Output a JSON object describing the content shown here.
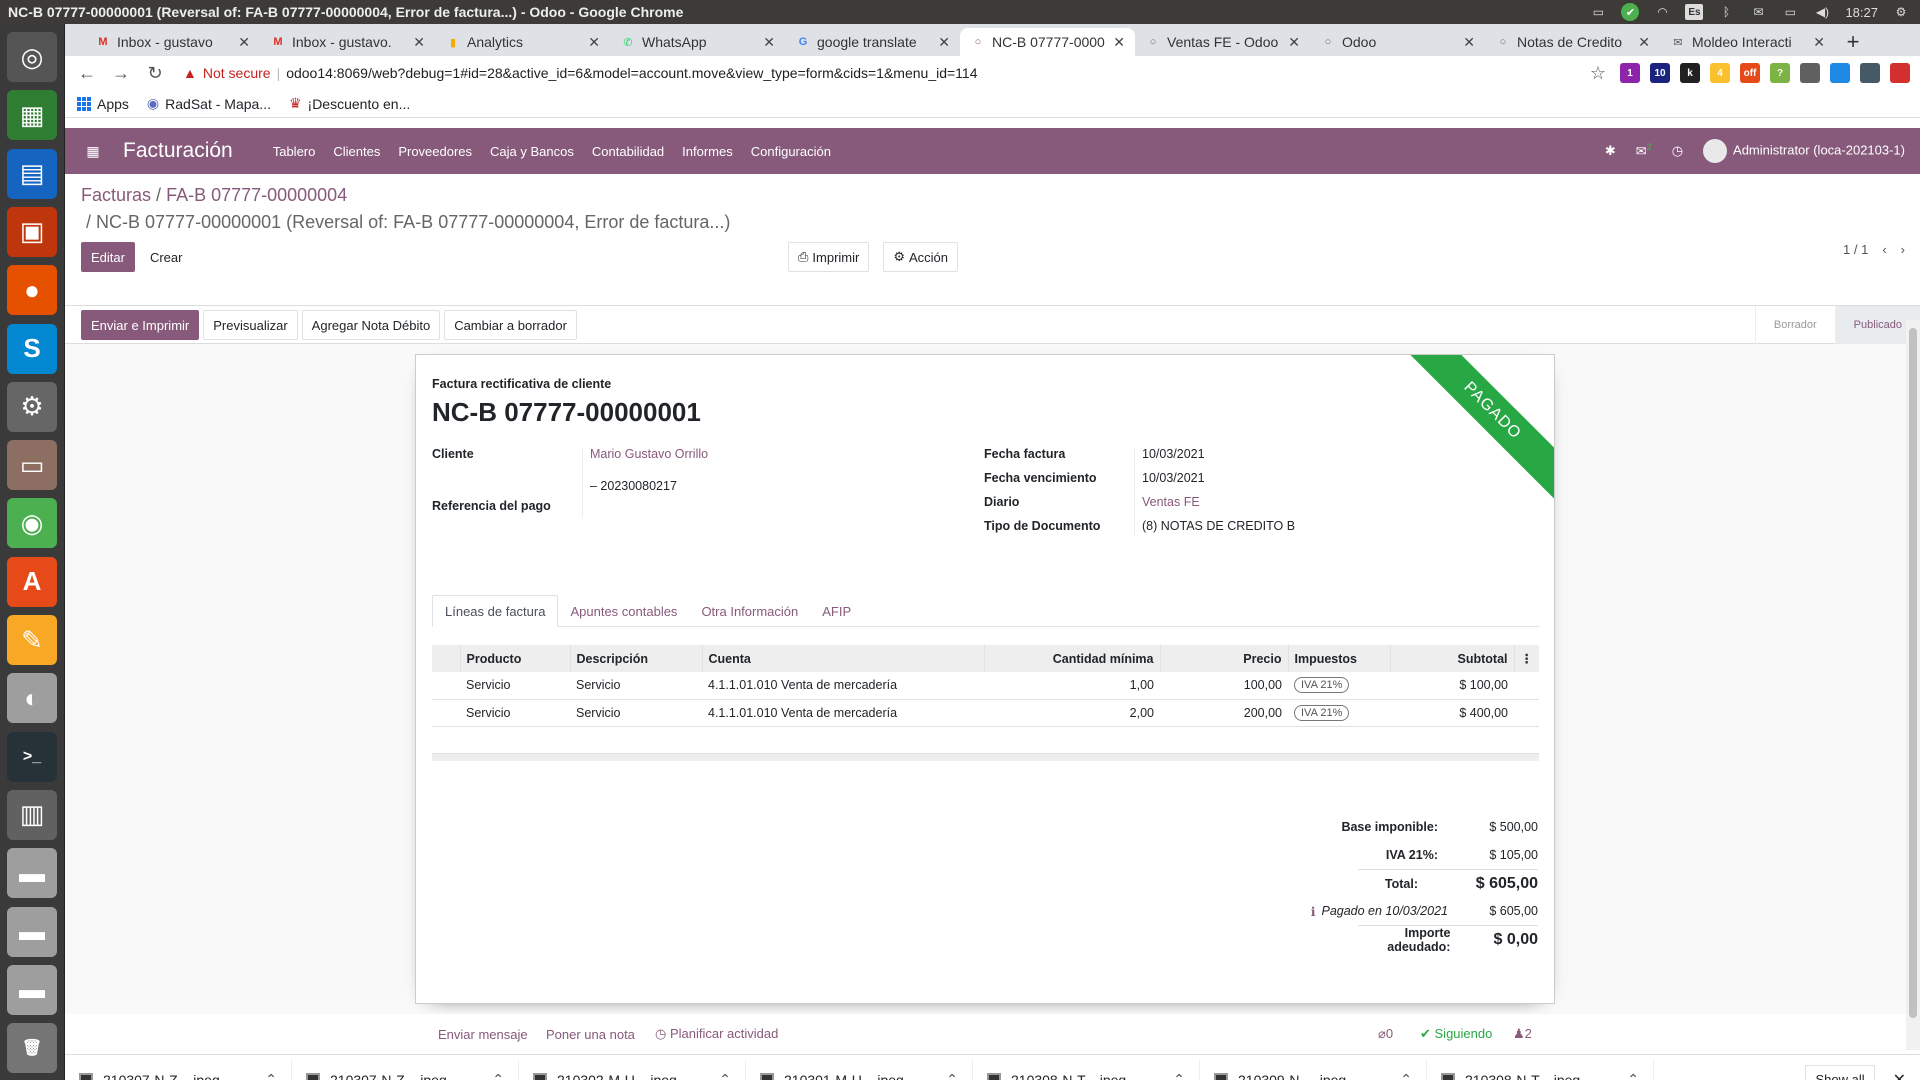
{
  "window_title": "NC-B 07777-00000001 (Reversal of: FA-B 07777-00000004, Error de factura...) - Odoo - Google Chrome",
  "system_tray": {
    "keyboard_layout": "Es",
    "time": "18:27"
  },
  "launcher": {
    "items": [
      {
        "name": "ubuntu-dash",
        "color": "#555",
        "glyph": "◎"
      },
      {
        "name": "spreadsheet-app",
        "color": "#2e7d32",
        "glyph": "▦"
      },
      {
        "name": "writer-app",
        "color": "#1565c0",
        "glyph": "▤"
      },
      {
        "name": "impress-app",
        "color": "#bf360c",
        "glyph": "▣"
      },
      {
        "name": "firefox-app",
        "color": "#e65100",
        "glyph": "●"
      },
      {
        "name": "skype-app",
        "color": "#0288d1",
        "glyph": "S"
      },
      {
        "name": "settings-app",
        "color": "#666",
        "glyph": "⚙"
      },
      {
        "name": "files-app",
        "color": "#8d6e63",
        "glyph": "▭"
      },
      {
        "name": "chrome-app",
        "color": "#4caf50",
        "glyph": "◉"
      },
      {
        "name": "software-center-app",
        "color": "#e64a19",
        "glyph": "A"
      },
      {
        "name": "text-editor-app",
        "color": "#f9a825",
        "glyph": "✎"
      },
      {
        "name": "disk-app",
        "color": "#9e9e9e",
        "glyph": "◐"
      },
      {
        "name": "terminal-app",
        "color": "#263238",
        "glyph": ">_"
      },
      {
        "name": "workspace-app",
        "color": "#616161",
        "glyph": "▥"
      },
      {
        "name": "drive-1-app",
        "color": "#9e9e9e",
        "glyph": "▬"
      },
      {
        "name": "drive-2-app",
        "color": "#9e9e9e",
        "glyph": "▬"
      },
      {
        "name": "drive-3-app",
        "color": "#9e9e9e",
        "glyph": "▬"
      },
      {
        "name": "trash-app",
        "color": "#757575",
        "glyph": "🗑"
      }
    ]
  },
  "browser": {
    "tabs": [
      {
        "title": "Inbox - gustavo",
        "icon": "M",
        "icon_color": "#d93025",
        "active": false
      },
      {
        "title": "Inbox - gustavo.",
        "icon": "M",
        "icon_color": "#d93025",
        "active": false
      },
      {
        "title": "Analytics",
        "icon": "▮",
        "icon_color": "#f9ab00",
        "active": false
      },
      {
        "title": "WhatsApp",
        "icon": "✆",
        "icon_color": "#25d366",
        "active": false
      },
      {
        "title": "google translate",
        "icon": "G",
        "icon_color": "#4285f4",
        "active": false
      },
      {
        "title": "NC-B 07777-0000",
        "icon": "○",
        "icon_color": "#875a7b",
        "active": true
      },
      {
        "title": "Ventas FE - Odoo",
        "icon": "○",
        "icon_color": "#875a7b",
        "active": false
      },
      {
        "title": "Odoo",
        "icon": "○",
        "icon_color": "#875a7b",
        "active": false
      },
      {
        "title": "Notas de Credito",
        "icon": "○",
        "icon_color": "#875a7b",
        "active": false
      },
      {
        "title": "Moldeo Interacti",
        "icon": "✉",
        "icon_color": "#555",
        "active": false
      }
    ],
    "security_label": "Not secure",
    "url": "odoo14:8069/web?debug=1#id=28&active_id=6&model=account.move&view_type=form&cids=1&menu_id=114",
    "extension_badges": [
      "1",
      "10",
      "k",
      "4",
      "off",
      "?",
      "",
      "",
      "",
      ""
    ],
    "bookmarks": [
      {
        "label": "Apps"
      },
      {
        "label": "RadSat - Mapa..."
      },
      {
        "label": "¡Descuento en..."
      }
    ]
  },
  "odoo": {
    "app_name": "Facturación",
    "menu": [
      "Tablero",
      "Clientes",
      "Proveedores",
      "Caja y Bancos",
      "Contabilidad",
      "Informes",
      "Configuración"
    ],
    "messages_count": "2",
    "user_label": "Administrator (loca-202103-1)",
    "accent_color": "#875a7b",
    "breadcrumb": {
      "root": "Facturas",
      "parent": "FA-B 07777-00000004",
      "current": "NC-B 07777-00000001 (Reversal of: FA-B 07777-00000004, Error de factura...)"
    },
    "buttons": {
      "edit": "Editar",
      "create": "Crear",
      "print": "Imprimir",
      "action": "Acción"
    },
    "pager": "1 / 1",
    "header_buttons": [
      "Enviar e Imprimir",
      "Previsualizar",
      "Agregar Nota Débito",
      "Cambiar a borrador"
    ],
    "status_steps": [
      {
        "label": "Borrador",
        "active": false
      },
      {
        "label": "Publicado",
        "active": true
      }
    ],
    "document": {
      "type_label": "Factura rectificativa de cliente",
      "number": "NC-B 07777-00000001",
      "ribbon": "PAGADO",
      "left_fields": {
        "cliente_label": "Cliente",
        "cliente_value": "Mario Gustavo Orrillo",
        "cliente_vat": "– 20230080217",
        "ref_pago_label": "Referencia del pago"
      },
      "right_fields": [
        {
          "label": "Fecha factura",
          "value": "10/03/2021",
          "link": false
        },
        {
          "label": "Fecha vencimiento",
          "value": "10/03/2021",
          "link": false
        },
        {
          "label": "Diario",
          "value": "Ventas FE",
          "link": true
        },
        {
          "label": "Tipo de Documento",
          "value": "(8) NOTAS DE CREDITO B",
          "link": false
        }
      ],
      "notebook_tabs": [
        "Líneas de factura",
        "Apuntes contables",
        "Otra Información",
        "AFIP"
      ],
      "table": {
        "columns": [
          "Producto",
          "Descripción",
          "Cuenta",
          "Cantidad mínima",
          "Precio",
          "Impuestos",
          "Subtotal"
        ],
        "rows": [
          {
            "producto": "Servicio",
            "descripcion": "Servicio",
            "cuenta": "4.1.1.01.010 Venta de mercadería",
            "cantidad": "1,00",
            "precio": "100,00",
            "impuesto": "IVA 21%",
            "subtotal": "$ 100,00"
          },
          {
            "producto": "Servicio",
            "descripcion": "Servicio",
            "cuenta": "4.1.1.01.010 Venta de mercadería",
            "cantidad": "2,00",
            "precio": "200,00",
            "impuesto": "IVA 21%",
            "subtotal": "$ 400,00"
          }
        ]
      },
      "totals": {
        "base_label": "Base imponible:",
        "base_value": "$ 500,00",
        "iva_label": "IVA 21%:",
        "iva_value": "$ 105,00",
        "total_label": "Total:",
        "total_value": "$ 605,00",
        "paid_label": "Pagado en 10/03/2021",
        "paid_value": "$ 605,00",
        "due_label": "Importe adeudado:",
        "due_value": "$ 0,00"
      }
    },
    "chatter": {
      "send_message": "Enviar mensaje",
      "log_note": "Poner una nota",
      "schedule": "Planificar actividad",
      "attachments": "0",
      "following": "Siguiendo",
      "followers": "2"
    }
  },
  "downloads": {
    "items": [
      "210307-N-Z....jpeg",
      "210307-N-Z....jpeg",
      "210302-M-U....jpeg",
      "210301-M-U....jpeg",
      "210308-N-T....jpeg",
      "210309-N-....jpeg",
      "210308-N-T....jpeg"
    ],
    "show_all": "Show all"
  }
}
